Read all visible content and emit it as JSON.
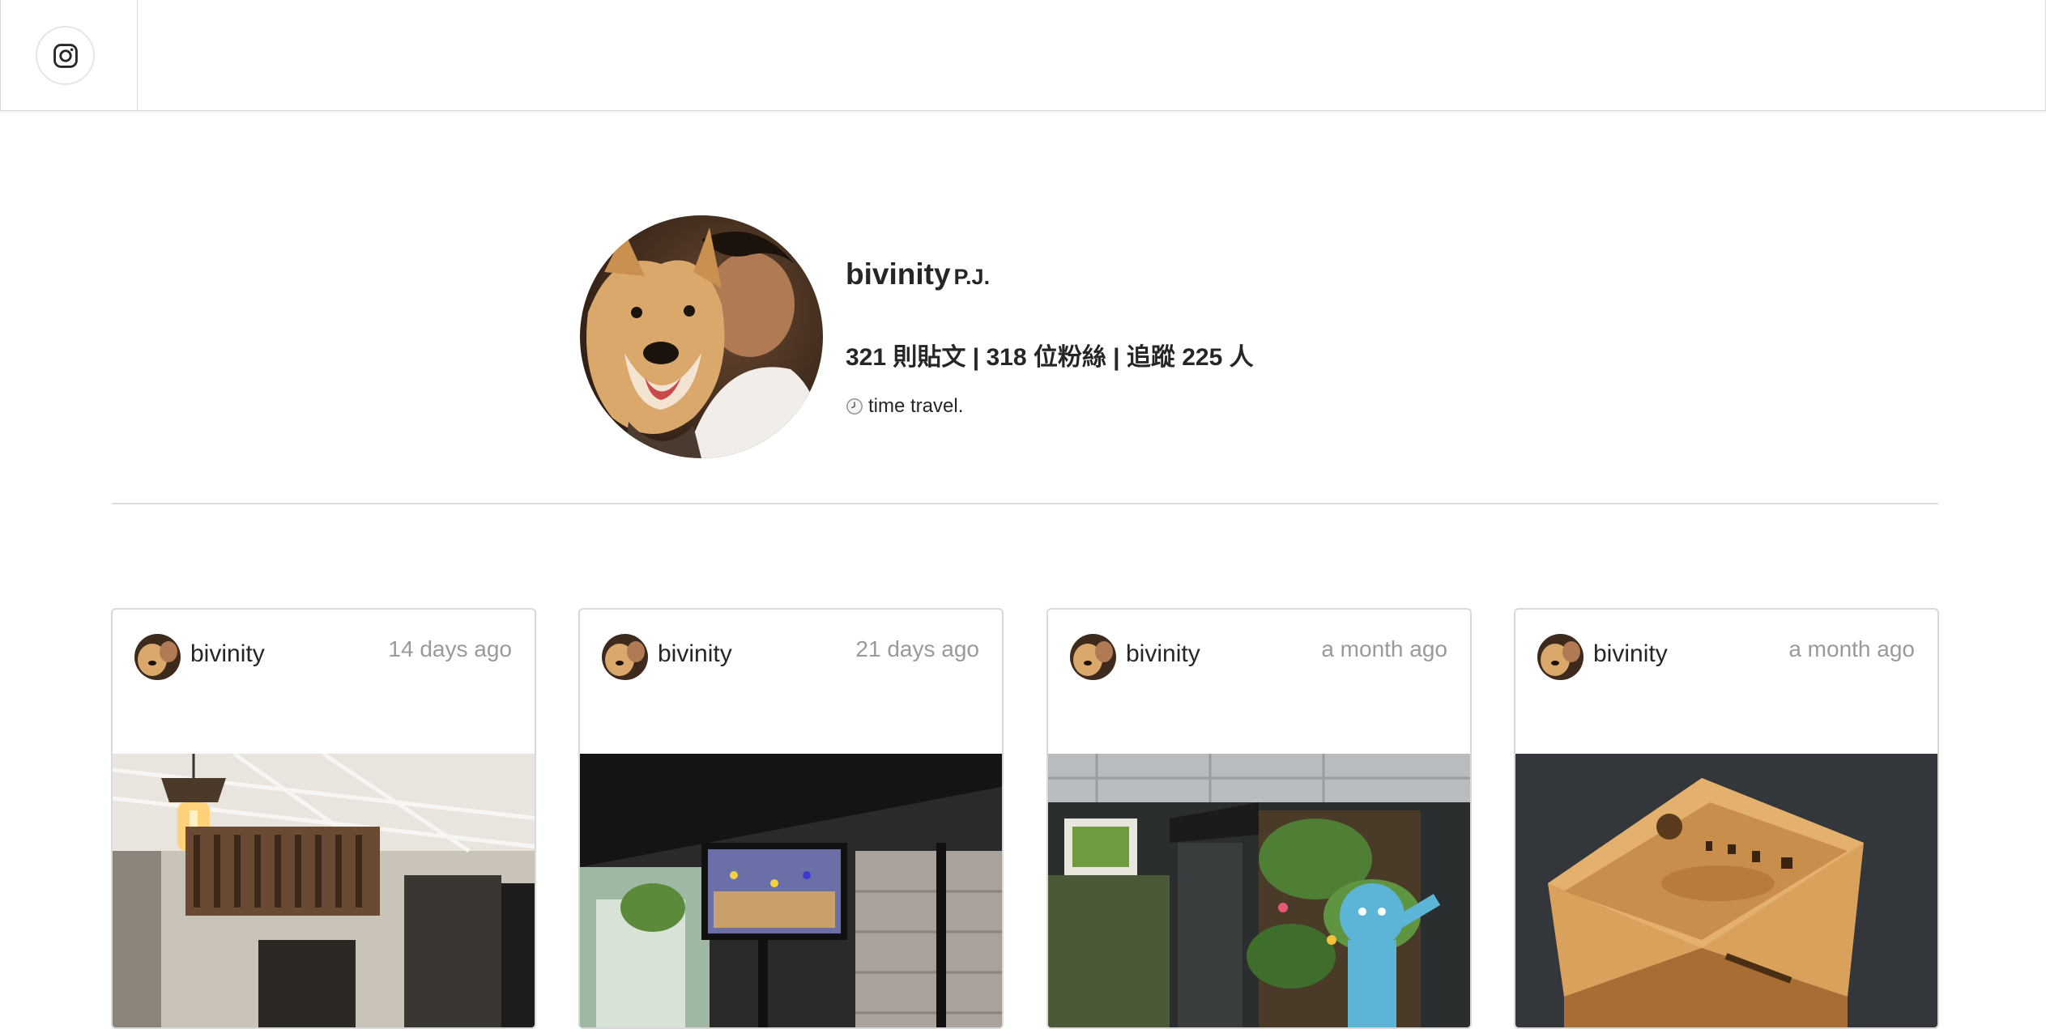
{
  "profile": {
    "username": "bivinity",
    "fullname": "P.J.",
    "stats": "321 則貼文 | 318 位粉絲 | 追蹤 225 人",
    "bio": "time travel.",
    "bio_icon": "clock-icon"
  },
  "header": {
    "logo_icon": "instagram-icon"
  },
  "posts": [
    {
      "user": "bivinity",
      "time": "14 days ago",
      "photo": "cafe-interior-lamp"
    },
    {
      "user": "bivinity",
      "time": "21 days ago",
      "photo": "bar-basketball-tv"
    },
    {
      "user": "bivinity",
      "time": "a month ago",
      "photo": "container-storefront-plants"
    },
    {
      "user": "bivinity",
      "time": "a month ago",
      "photo": "bamboo-phone-speaker"
    }
  ],
  "colors": {
    "border": "#d9d9d9",
    "muted": "#9a9a9a",
    "text": "#262626"
  }
}
